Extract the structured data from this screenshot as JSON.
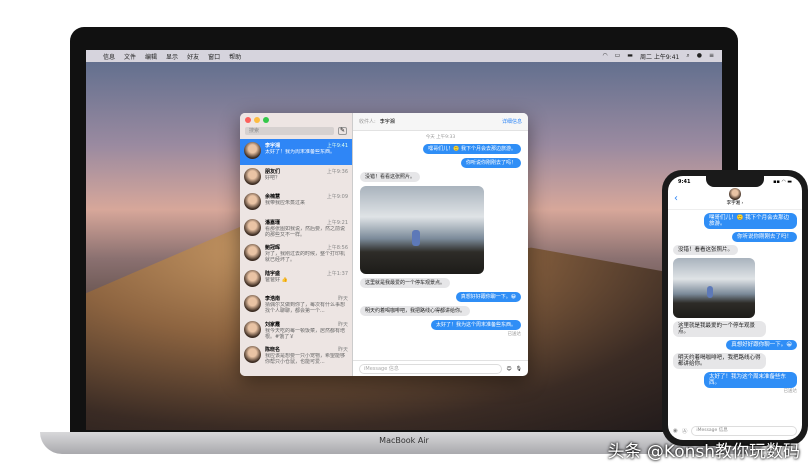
{
  "menubar": {
    "apple": "",
    "items": [
      "信息",
      "文件",
      "编辑",
      "显示",
      "好友",
      "窗口",
      "帮助"
    ],
    "clock": "周二 上午9:41",
    "status_icons": [
      "wifi-icon",
      "airplay-icon",
      "battery-icon",
      "search-icon",
      "siri-icon",
      "control-icon"
    ]
  },
  "laptop_label": "MacBook Air",
  "sidebar": {
    "search_placeholder": "搜索",
    "compose": "✎",
    "items": [
      {
        "name": "李宇湘",
        "time": "上午9:41",
        "preview": "太好了！我为周末准备些东西。"
      },
      {
        "name": "朋友们",
        "time": "上午9:36",
        "preview": "好吧？"
      },
      {
        "name": "余楠慧",
        "time": "上午9:09",
        "preview": "我带我应朱蒸过来"
      },
      {
        "name": "潘嘉瑾",
        "time": "上午9:21",
        "preview": "看那张图如我说，然后要，然之前说的那些又不一样。"
      },
      {
        "name": "鲍冠晖",
        "time": "上午8:56",
        "preview": "对了，我刚过去的时候，整个打印机就已经坏了。"
      },
      {
        "name": "陆宇盛",
        "time": "上午1:37",
        "preview": "爸爸好 👍"
      },
      {
        "name": "李浩南",
        "time": "昨天",
        "preview": "猜偶尔又做到你了，每次有什么事想找个人聊聊，都会第一个..."
      },
      {
        "name": "刘家霞",
        "time": "昨天",
        "preview": "我今天吃的每一顿饭菜，居然都有培根。#饿了￥"
      },
      {
        "name": "陈晓名",
        "time": "昨天",
        "preview": "我应该是想要一只小宠物，希望能够你帮只小仓鼠，也能可爱..."
      }
    ]
  },
  "chat": {
    "to_label": "收件人:",
    "recipient": "李宇湘",
    "details": "详细信息",
    "timestamp": "今天 上午9:33",
    "messages": [
      {
        "dir": "out",
        "text": "嘿哥们儿！🙂 我下个月会去那边旅游。"
      },
      {
        "dir": "out",
        "text": "你听说你刚刚去了吗！"
      },
      {
        "dir": "in",
        "text": "没错！看看这张照片。"
      },
      {
        "dir": "in",
        "text": "这里就是我最爱的一个停车观景点。"
      },
      {
        "dir": "out",
        "text": "真想好好跟你聊一下。😀"
      },
      {
        "dir": "in",
        "text": "明天约着喝咖啡吧，我把路线心得都讲给你。"
      },
      {
        "dir": "out",
        "text": "太好了！我为这个周末准备些东西。"
      }
    ],
    "delivered": "已送达",
    "input_placeholder": "iMessage 信息"
  },
  "phone": {
    "time": "9:41",
    "contact": "李宇湘 ›",
    "input_placeholder": "iMessage 信息",
    "delivered": "已送达"
  },
  "watermark": "头条 @Konsh教你玩数码"
}
